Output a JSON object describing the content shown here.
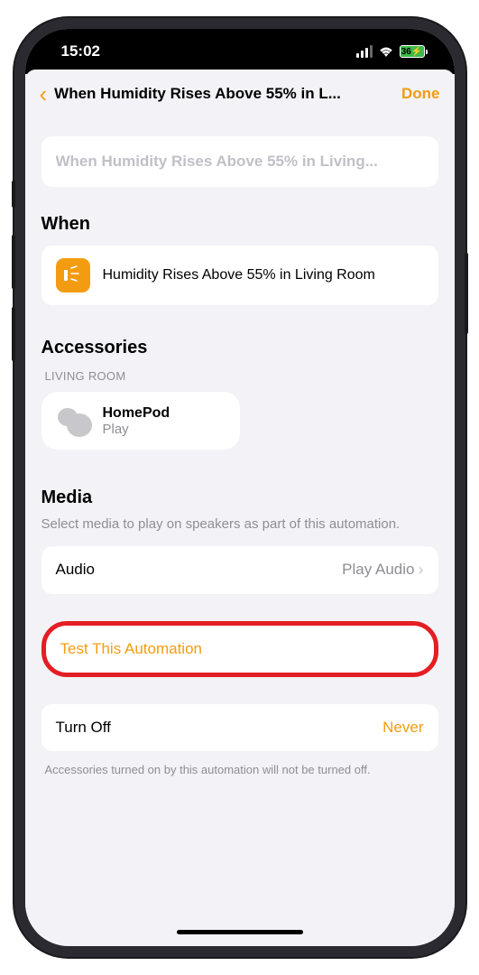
{
  "status": {
    "time": "15:02",
    "battery": "36"
  },
  "nav": {
    "title": "When Humidity Rises Above 55% in L...",
    "done": "Done"
  },
  "name_field": "When Humidity Rises Above 55% in Living...",
  "sections": {
    "when": {
      "title": "When",
      "condition": "Humidity Rises Above 55% in Living Room"
    },
    "accessories": {
      "title": "Accessories",
      "room": "LIVING ROOM",
      "items": [
        {
          "name": "HomePod",
          "status": "Play"
        }
      ]
    },
    "media": {
      "title": "Media",
      "subtitle": "Select media to play on speakers as part of this automation.",
      "audio_label": "Audio",
      "audio_value": "Play Audio"
    }
  },
  "test_button": "Test This Automation",
  "turnoff": {
    "label": "Turn Off",
    "value": "Never",
    "footer": "Accessories turned on by this automation will not be turned off."
  }
}
